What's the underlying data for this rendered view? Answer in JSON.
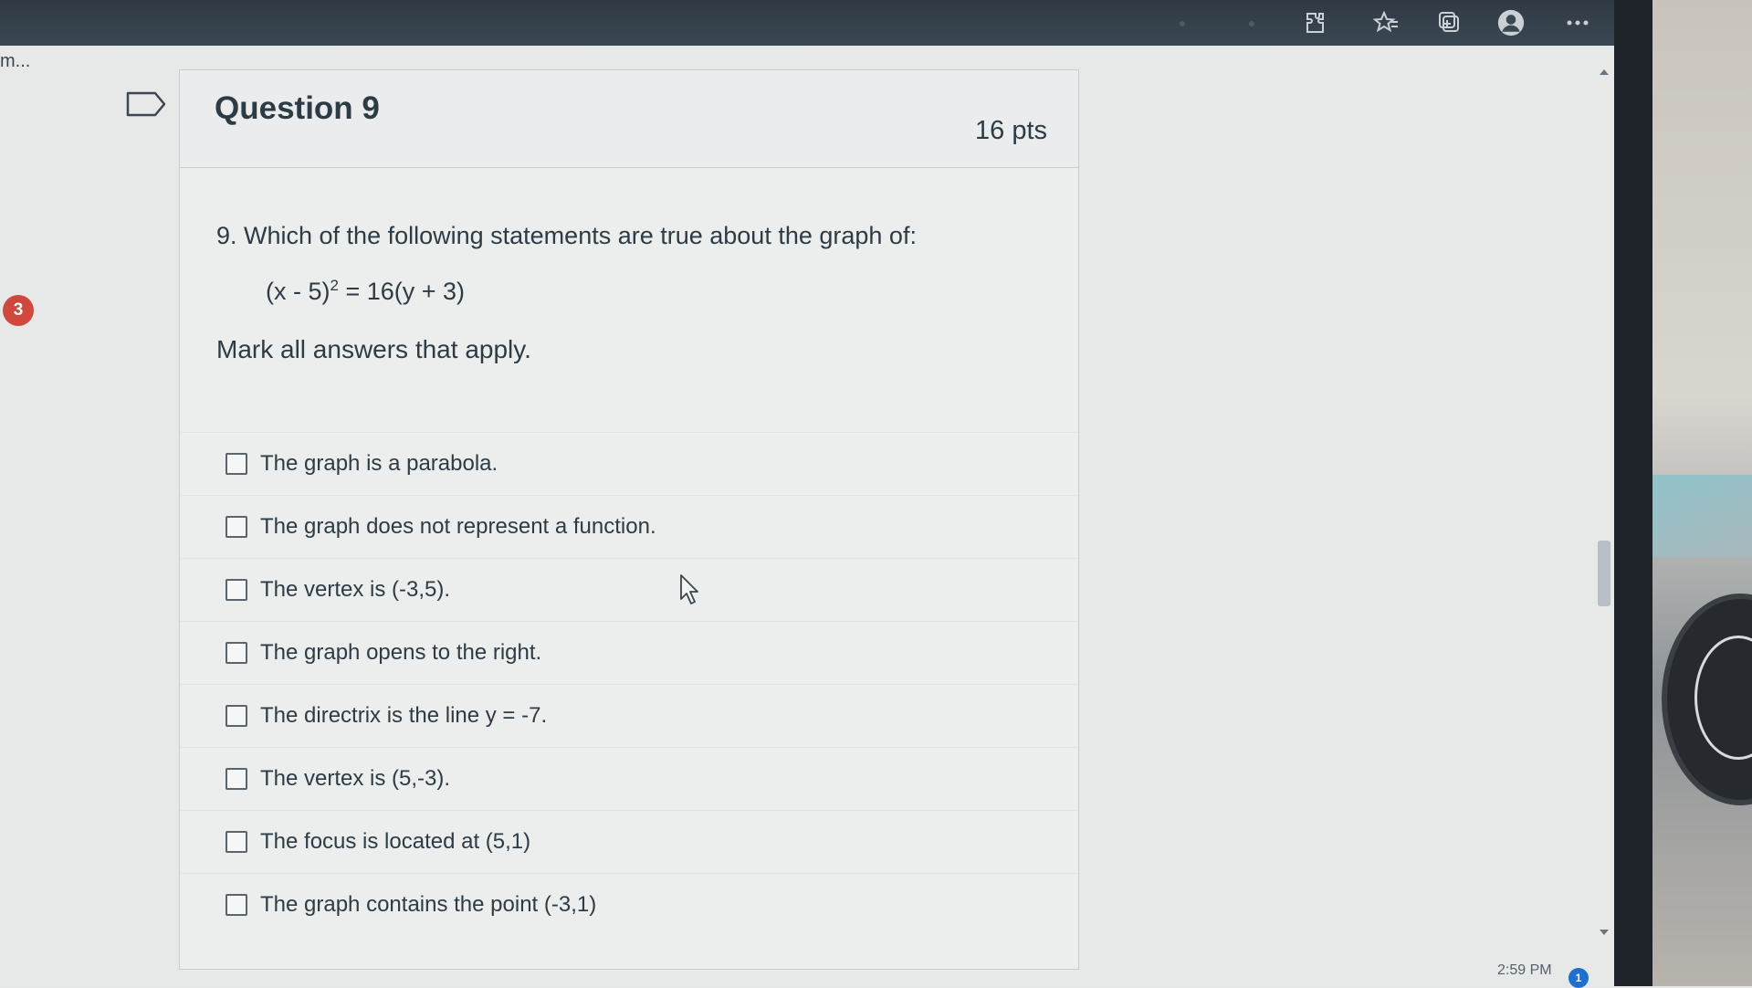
{
  "browser": {
    "toolbar_icons": [
      "extensions-icon",
      "favorites-icon",
      "collections-icon",
      "profile-icon",
      "more-icon"
    ]
  },
  "page": {
    "truncated_text": "m...",
    "notification_badge": "3"
  },
  "question": {
    "title": "Question 9",
    "points": "16 pts",
    "prompt": "9. Which of the following statements are true about the graph of:",
    "equation_left": "(x - 5)",
    "equation_exp": "2",
    "equation_right": " = 16(y + 3)",
    "instruction": "Mark all answers that apply.",
    "answers": [
      {
        "label": "The graph is a parabola.",
        "checked": false
      },
      {
        "label": "The graph does not represent a function.",
        "checked": false
      },
      {
        "label": "The vertex is (-3,5).",
        "checked": false
      },
      {
        "label": "The graph opens to the right.",
        "checked": false
      },
      {
        "label": "The directrix is the line y = -7.",
        "checked": false
      },
      {
        "label": "The vertex is (5,-3).",
        "checked": false
      },
      {
        "label": "The focus is located at (5,1)",
        "checked": false
      },
      {
        "label": "The graph contains the point (-3,1)",
        "checked": false
      }
    ]
  },
  "taskbar": {
    "clock": "2:59 PM",
    "notification_count": "1"
  },
  "colors": {
    "badge": "#d0473b",
    "text": "#2d3b45",
    "topbar": "#2f3a45"
  }
}
